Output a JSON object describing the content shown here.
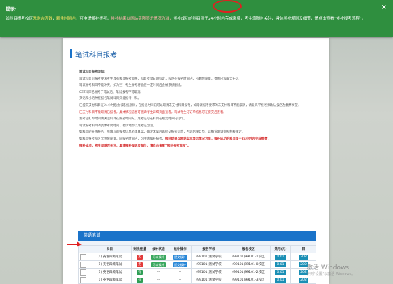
{
  "banner": {
    "title": "提示:",
    "close_label": "×",
    "text_parts": [
      {
        "text": "如科目报考校区",
        "style": "normal"
      },
      {
        "text": "无剩余席数",
        "style": "yellow"
      },
      {
        "text": "，",
        "style": "normal"
      },
      {
        "text": "剩余时间内",
        "style": "yellow"
      },
      {
        "text": "，可申请候补报考，",
        "style": "normal"
      },
      {
        "text": "候补结果以网站实际显示情况为准，",
        "style": "red"
      },
      {
        "text": "候补成功的科目须于24小时内完成缴费，考生须随时关注，具体候补规则及细节，请点击查看“候补报考流程”。",
        "style": "normal"
      }
    ]
  },
  "page": {
    "title": "笔试科目报考",
    "notice_title": "笔试科目报考须知:",
    "notice_lines": [
      {
        "text": "笔试科目报考须知:",
        "style": "title"
      },
      {
        "text": "笔试科目可报考要求考生具有科目报考资格，科目考试日期标定，校区在报名时间内，有剩余座量，费用已设置大于0。",
        "style": "normal"
      },
      {
        "text": "笔试报考科目不能冲突，如为空，考生报考将会在一定时间后会被系统删除。",
        "style": "normal"
      },
      {
        "text": "CET科目已报考了笔试后，笔试报考不可取消。",
        "style": "normal"
      },
      {
        "text": "英语和小语种报报名笔试科目只能报考一科。",
        "style": "normal"
      },
      {
        "text": "已提未支付科目在24小时后会被系统删除，在报名时间内可以取消未支付科目报考，如笔试报考要求的未支付科目不能取消，请联系学校老师确认报名及缴费事宜。",
        "style": "normal"
      },
      {
        "text": "已支付科目不能取消已报考，具体情况信息可查询考生详细页面查看，笔试考生订订单信息可在提交后查看。",
        "style": "red"
      },
      {
        "text": "准考证打印时间请关注科目在报名时间内，准考证可在科目在规定时间内打印。",
        "style": "normal"
      },
      {
        "text": "笔试报考科目的具体考试时间、考试地点以准考证为准。",
        "style": "normal"
      },
      {
        "text": "如科目的在线报名，所填写的报考信息必须真实，确定无误后再提交报名信息，否则后果自负，详细说明请参照相关规定。",
        "style": "normal"
      },
      {
        "text": "如科目报考校区无剩余座量，同报名时间内，可申请候补报考，",
        "style": "mixed_a"
      },
      {
        "text": "候补成功，考生须随时关注，具体候补规则及细节，请点击查看“候补报考流程”。",
        "style": "mixed_b"
      }
    ],
    "notice_red_a": "候补结果以网站实际显示情况为准，候补成功的科目须于24小时内完成缴费，",
    "notice_link": "“候补报考流程”"
  },
  "exam": {
    "tab_label": "英语笔试",
    "columns": [
      "",
      "科目",
      "剩余座量",
      "候补状态",
      "候补操作",
      "报名学校",
      "报名校区",
      "费用(元)",
      "日"
    ],
    "rows": [
      {
        "subject": "(1) 英语四级笔试",
        "seats": "无",
        "seats_color": "red",
        "status": "可以候补",
        "status_style": "pill-green",
        "action": "提交候补",
        "action_style": "pill-blue",
        "school": "(99101)测试学校",
        "campus": "(99101)99101-1校区",
        "fee": "0.01",
        "date": "202"
      },
      {
        "subject": "(1) 英语四级笔试",
        "seats": "无",
        "seats_color": "red",
        "status": "可以候补",
        "status_style": "pill-green",
        "action": "提交候补",
        "action_style": "pill-blue",
        "school": "(99101)测试学校",
        "campus": "(99101)99101-0校区",
        "fee": "0.01",
        "date": "202"
      },
      {
        "subject": "(1) 英语四级笔试",
        "seats": "有",
        "seats_color": "green",
        "status": "--",
        "status_style": "",
        "action": "--",
        "action_style": "",
        "school": "(99101)测试学校",
        "campus": "(99101)99101-2校区",
        "fee": "0.01",
        "date": "202"
      },
      {
        "subject": "(1) 英语四级笔试",
        "seats": "有",
        "seats_color": "green",
        "status": "--",
        "status_style": "",
        "action": "--",
        "action_style": "",
        "school": "(99101)测试学校",
        "campus": "(99101)99101-3校区",
        "fee": "0.01",
        "date": "202"
      },
      {
        "subject": "(1) 英语四级笔试",
        "seats": "有",
        "seats_color": "green",
        "status": "--",
        "status_style": "",
        "action": "--",
        "action_style": "",
        "school": "(99101)测试学校",
        "campus": "(99101)测试校区",
        "fee": "0.01",
        "date": "202"
      }
    ]
  },
  "watermark": {
    "line1": "激活 Windows",
    "line2": "转到“设置”以激活 Windows。"
  },
  "colors": {
    "banner_bg": "#2f8f3f",
    "accent_blue": "#1a73c9",
    "annotation_red": "#e02020"
  }
}
